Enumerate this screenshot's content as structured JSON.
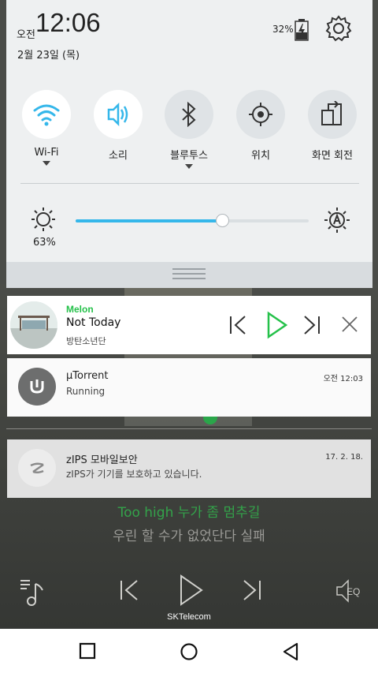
{
  "status": {
    "ampm": "오전",
    "time": "12:06",
    "date": "2월 23일 (목)",
    "battery": "32%",
    "icons": [
      "battery-icon",
      "gear-icon"
    ]
  },
  "quick_tiles": [
    {
      "label": "Wi-Fi",
      "icon": "wifi-icon",
      "active": true,
      "expandable": true
    },
    {
      "label": "소리",
      "icon": "sound-icon",
      "active": true,
      "expandable": false
    },
    {
      "label": "블루투스",
      "icon": "bluetooth-icon",
      "active": false,
      "expandable": true
    },
    {
      "label": "위치",
      "icon": "location-icon",
      "active": false,
      "expandable": false
    },
    {
      "label": "화면 회전",
      "icon": "rotate-icon",
      "active": false,
      "expandable": false
    }
  ],
  "brightness": {
    "percent_label": "63%",
    "level": 0.63
  },
  "notifications": {
    "melon": {
      "app": "Melon",
      "title": "Not Today",
      "artist": "방탄소년단"
    },
    "torrent": {
      "title": "µTorrent",
      "text": "Running",
      "time": "오전 12:03"
    },
    "zips": {
      "title": "zIPS 모바일보안",
      "text": "zIPS가 기기를 보호하고 있습니다.",
      "time": "17. 2. 18."
    }
  },
  "background_player": {
    "lyric_line1": "Too high 누가 좀 멈추길",
    "lyric_line2": "우린 할 수가 없었단다 실패",
    "carrier": "SKTelecom",
    "eq_label": "EQ"
  },
  "colors": {
    "accent_blue": "#35b7ea",
    "melon_green": "#25c14a"
  }
}
